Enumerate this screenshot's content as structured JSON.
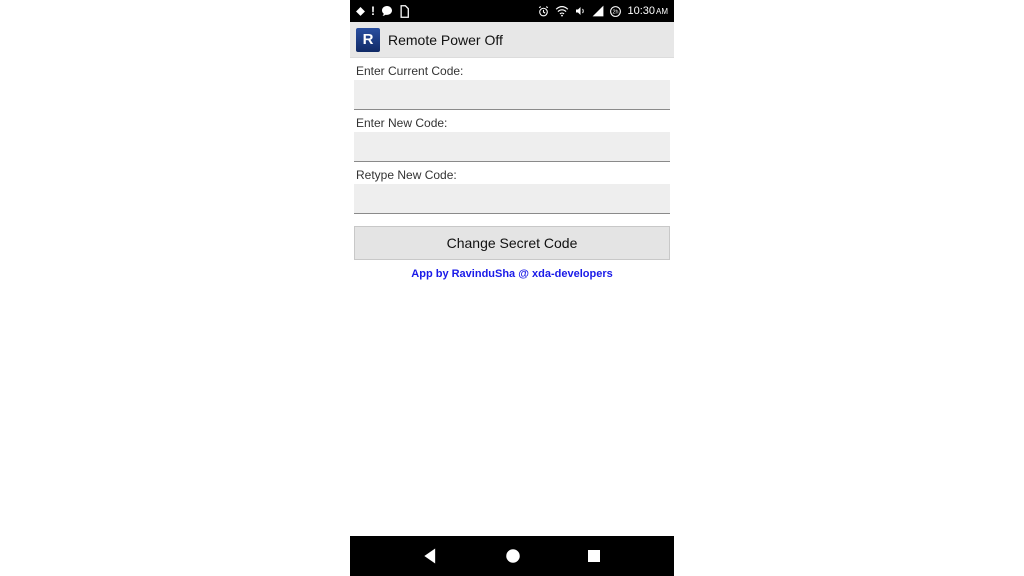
{
  "status_bar": {
    "time": "10:30",
    "ampm": "AM"
  },
  "app": {
    "icon_letter": "R",
    "title": "Remote Power Off"
  },
  "fields": {
    "current": {
      "label": "Enter Current Code:",
      "value": ""
    },
    "newcode": {
      "label": "Enter New Code:",
      "value": ""
    },
    "retype": {
      "label": "Retype New Code:",
      "value": ""
    }
  },
  "button": {
    "change_label": "Change Secret Code"
  },
  "credit": "App by RavinduSha @ xda-developers"
}
